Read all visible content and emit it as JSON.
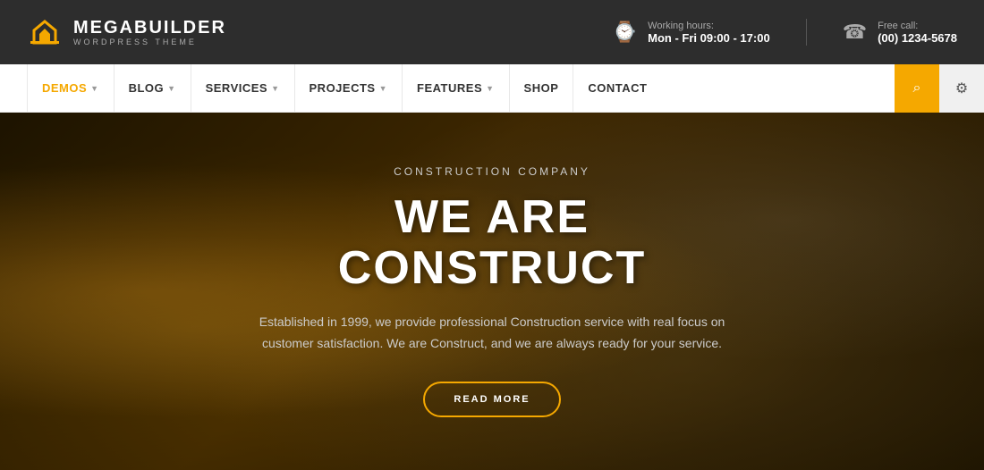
{
  "topbar": {
    "brand": "MEGABUILDER",
    "sub": "WORDPRESS THEME",
    "working_label": "Working hours:",
    "working_value": "Mon - Fri 09:00 - 17:00",
    "call_label": "Free call:",
    "call_value": "(00) 1234-5678"
  },
  "nav": {
    "items": [
      {
        "label": "DEMOS",
        "has_dropdown": true,
        "active": true
      },
      {
        "label": "BLOG",
        "has_dropdown": true,
        "active": false
      },
      {
        "label": "SERVICES",
        "has_dropdown": true,
        "active": false
      },
      {
        "label": "PROJECTS",
        "has_dropdown": true,
        "active": false
      },
      {
        "label": "FEATURES",
        "has_dropdown": true,
        "active": false
      },
      {
        "label": "SHOP",
        "has_dropdown": false,
        "active": false
      },
      {
        "label": "CONTACT",
        "has_dropdown": false,
        "active": false
      }
    ]
  },
  "hero": {
    "subtitle": "CONSTRUCTION COMPANY",
    "title": "WE ARE CONSTRUCT",
    "description": "Established in 1999, we provide professional Construction service with real focus on customer satisfaction. We are Construct, and we are always ready for your service.",
    "button_label": "READ MORE"
  }
}
